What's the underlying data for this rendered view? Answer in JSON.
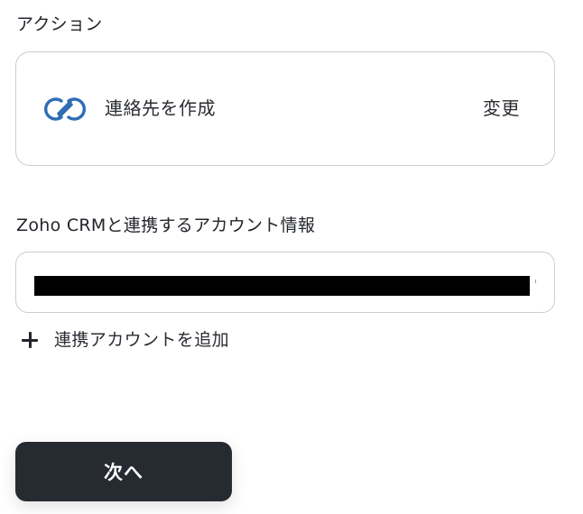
{
  "action_section": {
    "label": "アクション",
    "action_name": "連絡先を作成",
    "change_label": "変更",
    "icon": "zoho-crm-icon"
  },
  "account_section": {
    "label": "Zoho CRMと連携するアカウント情報",
    "add_account_label": "連携アカウントを追加"
  },
  "footer": {
    "next_label": "次へ"
  },
  "colors": {
    "zoho_blue": "#2f6db5",
    "button_dark": "#262a31",
    "border": "#c9cdd2"
  }
}
